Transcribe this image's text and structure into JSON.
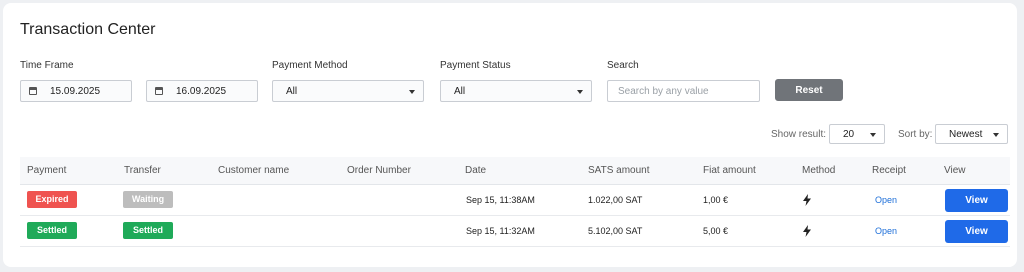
{
  "page": {
    "title": "Transaction Center"
  },
  "filters": {
    "time_frame_label": "Time Frame",
    "date_from": "15.09.2025",
    "date_to": "16.09.2025",
    "payment_method_label": "Payment Method",
    "payment_method_value": "All",
    "payment_status_label": "Payment Status",
    "payment_status_value": "All",
    "search_label": "Search",
    "search_placeholder": "Search by any value",
    "reset_label": "Reset"
  },
  "controls": {
    "show_result_label": "Show result:",
    "show_result_value": "20",
    "sort_by_label": "Sort by:",
    "sort_by_value": "Newest"
  },
  "table": {
    "headers": [
      "Payment",
      "Transfer",
      "Customer name",
      "Order Number",
      "Date",
      "SATS amount",
      "Fiat amount",
      "Method",
      "Receipt",
      "View"
    ],
    "rows": [
      {
        "payment": "Expired",
        "transfer": "Waiting",
        "customer": "",
        "order": "",
        "date": "Sep 15, 11:38AM",
        "sats": "1.022,00 SAT",
        "fiat": "1,00 €",
        "method_icon": "lightning-icon",
        "receipt": "Open",
        "view": "View"
      },
      {
        "payment": "Settled",
        "transfer": "Settled",
        "customer": "",
        "order": "",
        "date": "Sep 15, 11:32AM",
        "sats": "5.102,00 SAT",
        "fiat": "5,00 €",
        "method_icon": "lightning-icon",
        "receipt": "Open",
        "view": "View"
      }
    ]
  },
  "colors": {
    "expired": "#ef5350",
    "waiting": "#bdbdbd",
    "settled": "#1faa59",
    "primary": "#1f6ae8",
    "reset": "#707479",
    "link": "#1e6fd9"
  }
}
